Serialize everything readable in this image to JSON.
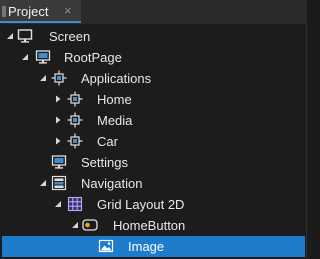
{
  "panel": {
    "tab_label": "Project",
    "close_glyph": "×"
  },
  "tree": {
    "items": [
      {
        "label": "Screen",
        "icon": "monitor-icon",
        "expanded": true
      },
      {
        "label": "RootPage",
        "icon": "page-icon",
        "expanded": true
      },
      {
        "label": "Applications",
        "icon": "node-icon",
        "expanded": true
      },
      {
        "label": "Home",
        "icon": "node-icon",
        "expanded": false
      },
      {
        "label": "Media",
        "icon": "node-icon",
        "expanded": false
      },
      {
        "label": "Car",
        "icon": "node-icon",
        "expanded": false
      },
      {
        "label": "Settings",
        "icon": "page-icon",
        "expanded": null
      },
      {
        "label": "Navigation",
        "icon": "navigation-icon",
        "expanded": true
      },
      {
        "label": "Grid Layout 2D",
        "icon": "grid-icon",
        "expanded": true
      },
      {
        "label": "HomeButton",
        "icon": "button-icon",
        "expanded": true
      },
      {
        "label": "Image",
        "icon": "image-icon",
        "expanded": null,
        "selected": true
      }
    ]
  },
  "colors": {
    "selection": "#1e7ccd",
    "tab_accent": "#3d8fd1",
    "background": "#1c1c1c"
  }
}
